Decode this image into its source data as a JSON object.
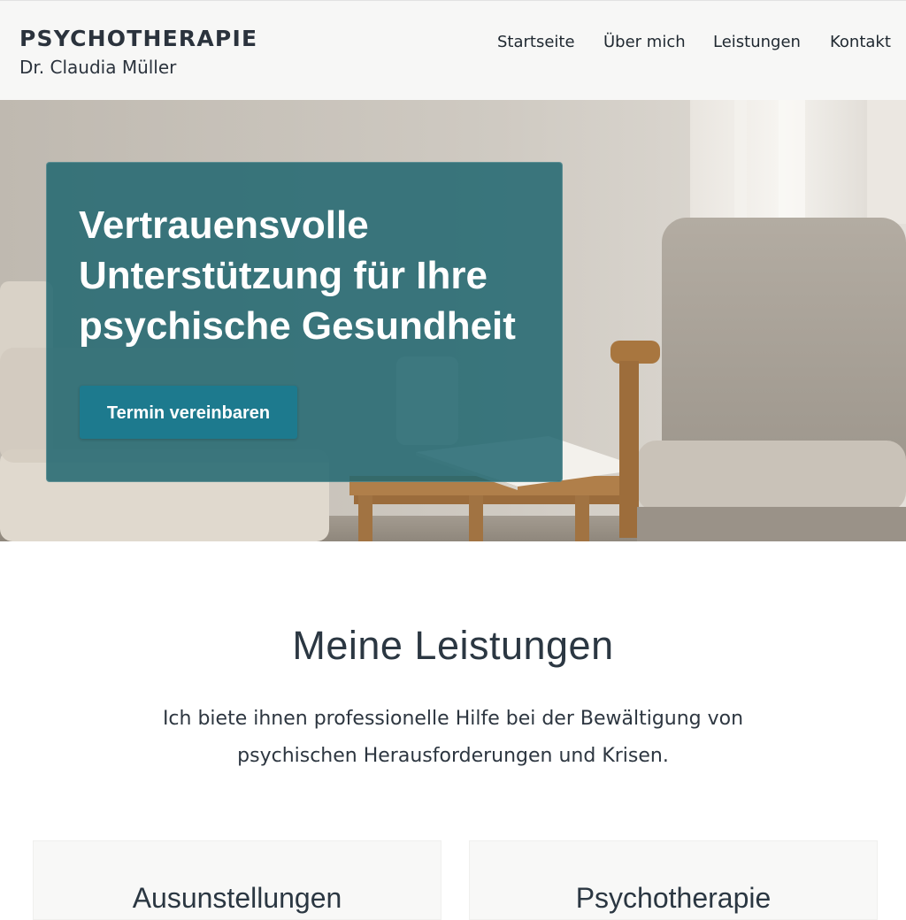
{
  "header": {
    "brand_title": "PSYCHOTHERAPIE",
    "brand_subtitle": "Dr. Claudia Müller",
    "nav": {
      "startseite": "Startseite",
      "ueber_mich": "Über mich",
      "leistungen": "Leistungen",
      "kontakt": "Kontakt"
    }
  },
  "hero": {
    "heading": "Vertrauensvolle Unterstützung für Ihre psychische Gesundheit",
    "cta_label": "Termin vereinbaren",
    "colors": {
      "card_overlay": "#216670",
      "button": "#1d7a8e"
    }
  },
  "services": {
    "heading": "Meine Leistungen",
    "intro": "Ich biete ihnen professionelle Hilfe bei der Bewältigung von psychischen Herausforderungen und Krisen.",
    "cards": [
      {
        "title": "Ausunstellungen"
      },
      {
        "title": "Psychotherapie"
      }
    ]
  }
}
